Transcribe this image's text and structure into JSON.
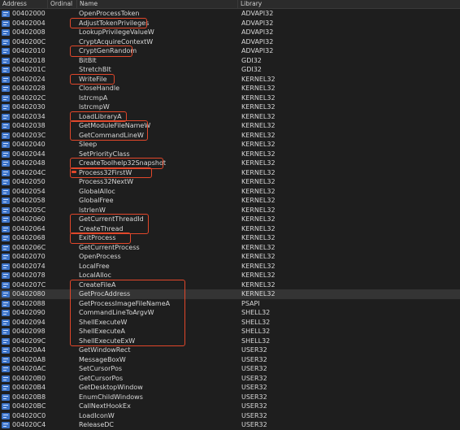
{
  "columns": {
    "address": "Address",
    "ordinal": "Ordinal",
    "name": "Name",
    "library": "Library"
  },
  "rows": [
    {
      "address": "00402000",
      "name": "OpenProcessToken",
      "library": "ADVAPI32"
    },
    {
      "address": "00402004",
      "name": "AdjustTokenPrivileges",
      "library": "ADVAPI32"
    },
    {
      "address": "00402008",
      "name": "LookupPrivilegeValueW",
      "library": "ADVAPI32"
    },
    {
      "address": "0040200C",
      "name": "CryptAcquireContextW",
      "library": "ADVAPI32"
    },
    {
      "address": "00402010",
      "name": "CryptGenRandom",
      "library": "ADVAPI32"
    },
    {
      "address": "00402018",
      "name": "BitBlt",
      "library": "GDI32"
    },
    {
      "address": "0040201C",
      "name": "StretchBlt",
      "library": "GDI32"
    },
    {
      "address": "00402024",
      "name": "WriteFile",
      "library": "KERNEL32"
    },
    {
      "address": "00402028",
      "name": "CloseHandle",
      "library": "KERNEL32"
    },
    {
      "address": "0040202C",
      "name": "lstrcmpA",
      "library": "KERNEL32"
    },
    {
      "address": "00402030",
      "name": "lstrcmpW",
      "library": "KERNEL32"
    },
    {
      "address": "00402034",
      "name": "LoadLibraryA",
      "library": "KERNEL32"
    },
    {
      "address": "00402038",
      "name": "GetModuleFileNameW",
      "library": "KERNEL32"
    },
    {
      "address": "0040203C",
      "name": "GetCommandLineW",
      "library": "KERNEL32"
    },
    {
      "address": "00402040",
      "name": "Sleep",
      "library": "KERNEL32"
    },
    {
      "address": "00402044",
      "name": "SetPriorityClass",
      "library": "KERNEL32"
    },
    {
      "address": "00402048",
      "name": "CreateToolhelp32Snapshot",
      "library": "KERNEL32"
    },
    {
      "address": "0040204C",
      "name": "Process32FirstW",
      "library": "KERNEL32"
    },
    {
      "address": "00402050",
      "name": "Process32NextW",
      "library": "KERNEL32"
    },
    {
      "address": "00402054",
      "name": "GlobalAlloc",
      "library": "KERNEL32"
    },
    {
      "address": "00402058",
      "name": "GlobalFree",
      "library": "KERNEL32"
    },
    {
      "address": "0040205C",
      "name": "lstrlenW",
      "library": "KERNEL32"
    },
    {
      "address": "00402060",
      "name": "GetCurrentThreadId",
      "library": "KERNEL32"
    },
    {
      "address": "00402064",
      "name": "CreateThread",
      "library": "KERNEL32"
    },
    {
      "address": "00402068",
      "name": "ExitProcess",
      "library": "KERNEL32"
    },
    {
      "address": "0040206C",
      "name": "GetCurrentProcess",
      "library": "KERNEL32"
    },
    {
      "address": "00402070",
      "name": "OpenProcess",
      "library": "KERNEL32"
    },
    {
      "address": "00402074",
      "name": "LocalFree",
      "library": "KERNEL32"
    },
    {
      "address": "00402078",
      "name": "LocalAlloc",
      "library": "KERNEL32"
    },
    {
      "address": "0040207C",
      "name": "CreateFileA",
      "library": "KERNEL32"
    },
    {
      "address": "00402080",
      "name": "GetProcAddress",
      "library": "KERNEL32",
      "selected": true
    },
    {
      "address": "00402088",
      "name": "GetProcessImageFileNameA",
      "library": "PSAPI"
    },
    {
      "address": "00402090",
      "name": "CommandLineToArgvW",
      "library": "SHELL32"
    },
    {
      "address": "00402094",
      "name": "ShellExecuteW",
      "library": "SHELL32"
    },
    {
      "address": "00402098",
      "name": "ShellExecuteA",
      "library": "SHELL32"
    },
    {
      "address": "0040209C",
      "name": "ShellExecuteExW",
      "library": "SHELL32"
    },
    {
      "address": "004020A4",
      "name": "GetWindowRect",
      "library": "USER32"
    },
    {
      "address": "004020A8",
      "name": "MessageBoxW",
      "library": "USER32"
    },
    {
      "address": "004020AC",
      "name": "SetCursorPos",
      "library": "USER32"
    },
    {
      "address": "004020B0",
      "name": "GetCursorPos",
      "library": "USER32"
    },
    {
      "address": "004020B4",
      "name": "GetDesktopWindow",
      "library": "USER32"
    },
    {
      "address": "004020B8",
      "name": "EnumChildWindows",
      "library": "USER32"
    },
    {
      "address": "004020BC",
      "name": "CallNextHookEx",
      "library": "USER32"
    },
    {
      "address": "004020C0",
      "name": "LoadIconW",
      "library": "USER32"
    },
    {
      "address": "004020C4",
      "name": "ReleaseDC",
      "library": "USER32"
    }
  ],
  "row_icon": "import-function-icon",
  "colors": {
    "background": "#1e1e1e",
    "highlight": "#e2472a",
    "icon": "#3d74c8"
  }
}
